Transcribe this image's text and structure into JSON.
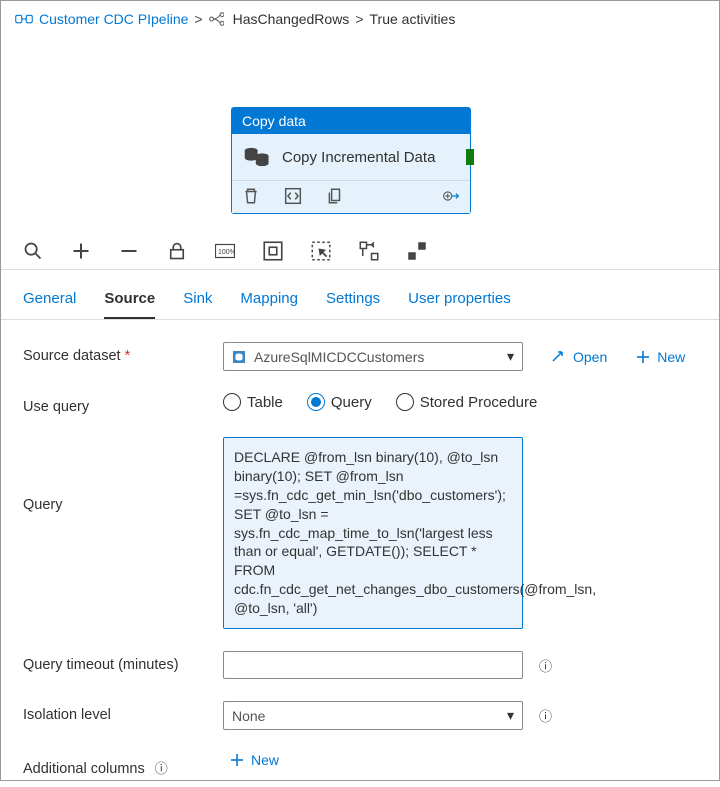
{
  "breadcrumb": {
    "root_label": "Customer CDC PIpeline",
    "cond_label": "HasChangedRows",
    "leaf_label": "True activities"
  },
  "activity": {
    "header": "Copy data",
    "title": "Copy Incremental Data"
  },
  "tabs": {
    "general": "General",
    "source": "Source",
    "sink": "Sink",
    "mapping": "Mapping",
    "settings": "Settings",
    "user_props": "User properties"
  },
  "form": {
    "source_dataset_label": "Source dataset",
    "source_dataset_value": "AzureSqlMICDCCustomers",
    "open_label": "Open",
    "new_label": "New",
    "use_query_label": "Use query",
    "query_label": "Query",
    "query_timeout_label": "Query timeout (minutes)",
    "isolation_label": "Isolation level",
    "isolation_value": "None",
    "additional_cols_label": "Additional columns",
    "radio": {
      "table": "Table",
      "query": "Query",
      "sproc": "Stored Procedure"
    },
    "query_text": "DECLARE @from_lsn binary(10), @to_lsn binary(10); SET @from_lsn =sys.fn_cdc_get_min_lsn('dbo_customers'); SET @to_lsn = sys.fn_cdc_map_time_to_lsn('largest less than or equal', GETDATE()); SELECT * FROM cdc.fn_cdc_get_net_changes_dbo_customers(@from_lsn, @to_lsn, 'all')"
  }
}
